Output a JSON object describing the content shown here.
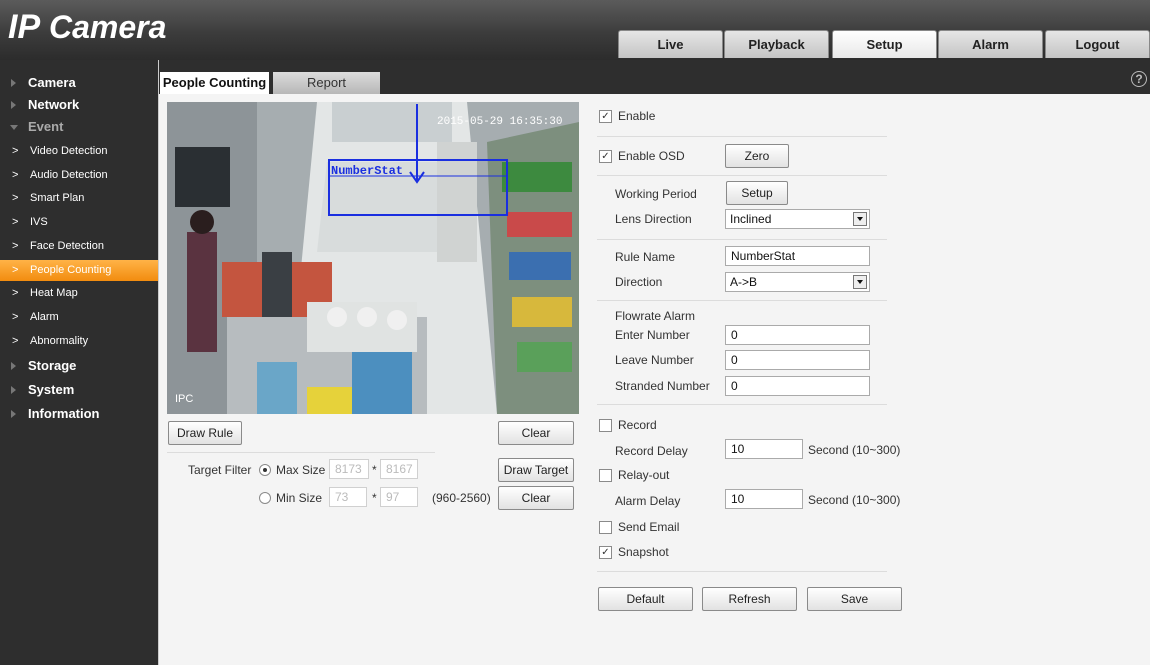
{
  "header": {
    "logo_ip": "IP",
    "logo_camera": " Camera",
    "nav": [
      "Live",
      "Playback",
      "Setup",
      "Alarm",
      "Logout"
    ],
    "active_nav": "Setup"
  },
  "sidebar": {
    "camera": "Camera",
    "network": "Network",
    "event": "Event",
    "event_items": [
      "Video Detection",
      "Audio Detection",
      "Smart Plan",
      "IVS",
      "Face Detection",
      "People Counting",
      "Heat Map",
      "Alarm",
      "Abnormality"
    ],
    "active_item": "People Counting",
    "storage": "Storage",
    "system": "System",
    "information": "Information"
  },
  "tabs": {
    "people_counting": "People Counting",
    "report": "Report"
  },
  "video": {
    "timestamp": "2015-05-29 16:35:30",
    "rule_label": "NumberStat",
    "channel": "IPC"
  },
  "left_panel": {
    "draw_rule": "Draw Rule",
    "clear_1": "Clear",
    "target_filter": "Target Filter",
    "max_size": "Max Size",
    "max_w": "8173",
    "max_h": "8167",
    "min_size": "Min Size",
    "min_w": "73",
    "min_h": "97",
    "times": "*",
    "range": "(960-2560)",
    "draw_target": "Draw Target",
    "clear_2": "Clear"
  },
  "right_panel": {
    "enable": "Enable",
    "enable_osd": "Enable OSD",
    "zero": "Zero",
    "working_period": "Working Period",
    "setup": "Setup",
    "lens_direction": "Lens Direction",
    "lens_direction_value": "Inclined",
    "rule_name": "Rule Name",
    "rule_name_value": "NumberStat",
    "direction": "Direction",
    "direction_value": "A->B",
    "flowrate_alarm": "Flowrate Alarm",
    "enter_number": "Enter Number",
    "enter_number_value": "0",
    "leave_number": "Leave Number",
    "leave_number_value": "0",
    "stranded_number": "Stranded Number",
    "stranded_number_value": "0",
    "record": "Record",
    "record_delay": "Record Delay",
    "record_delay_value": "10",
    "second_range_1": "Second (10~300)",
    "relay_out": "Relay-out",
    "alarm_delay": "Alarm Delay",
    "alarm_delay_value": "10",
    "second_range_2": "Second (10~300)",
    "send_email": "Send Email",
    "snapshot": "Snapshot",
    "default": "Default",
    "refresh": "Refresh",
    "save": "Save",
    "checkmark": "✓"
  },
  "colors": {
    "active_orange": "#f28c0f",
    "header_dark": "#3c3c3c",
    "rule_blue": "#1a2fe0"
  }
}
